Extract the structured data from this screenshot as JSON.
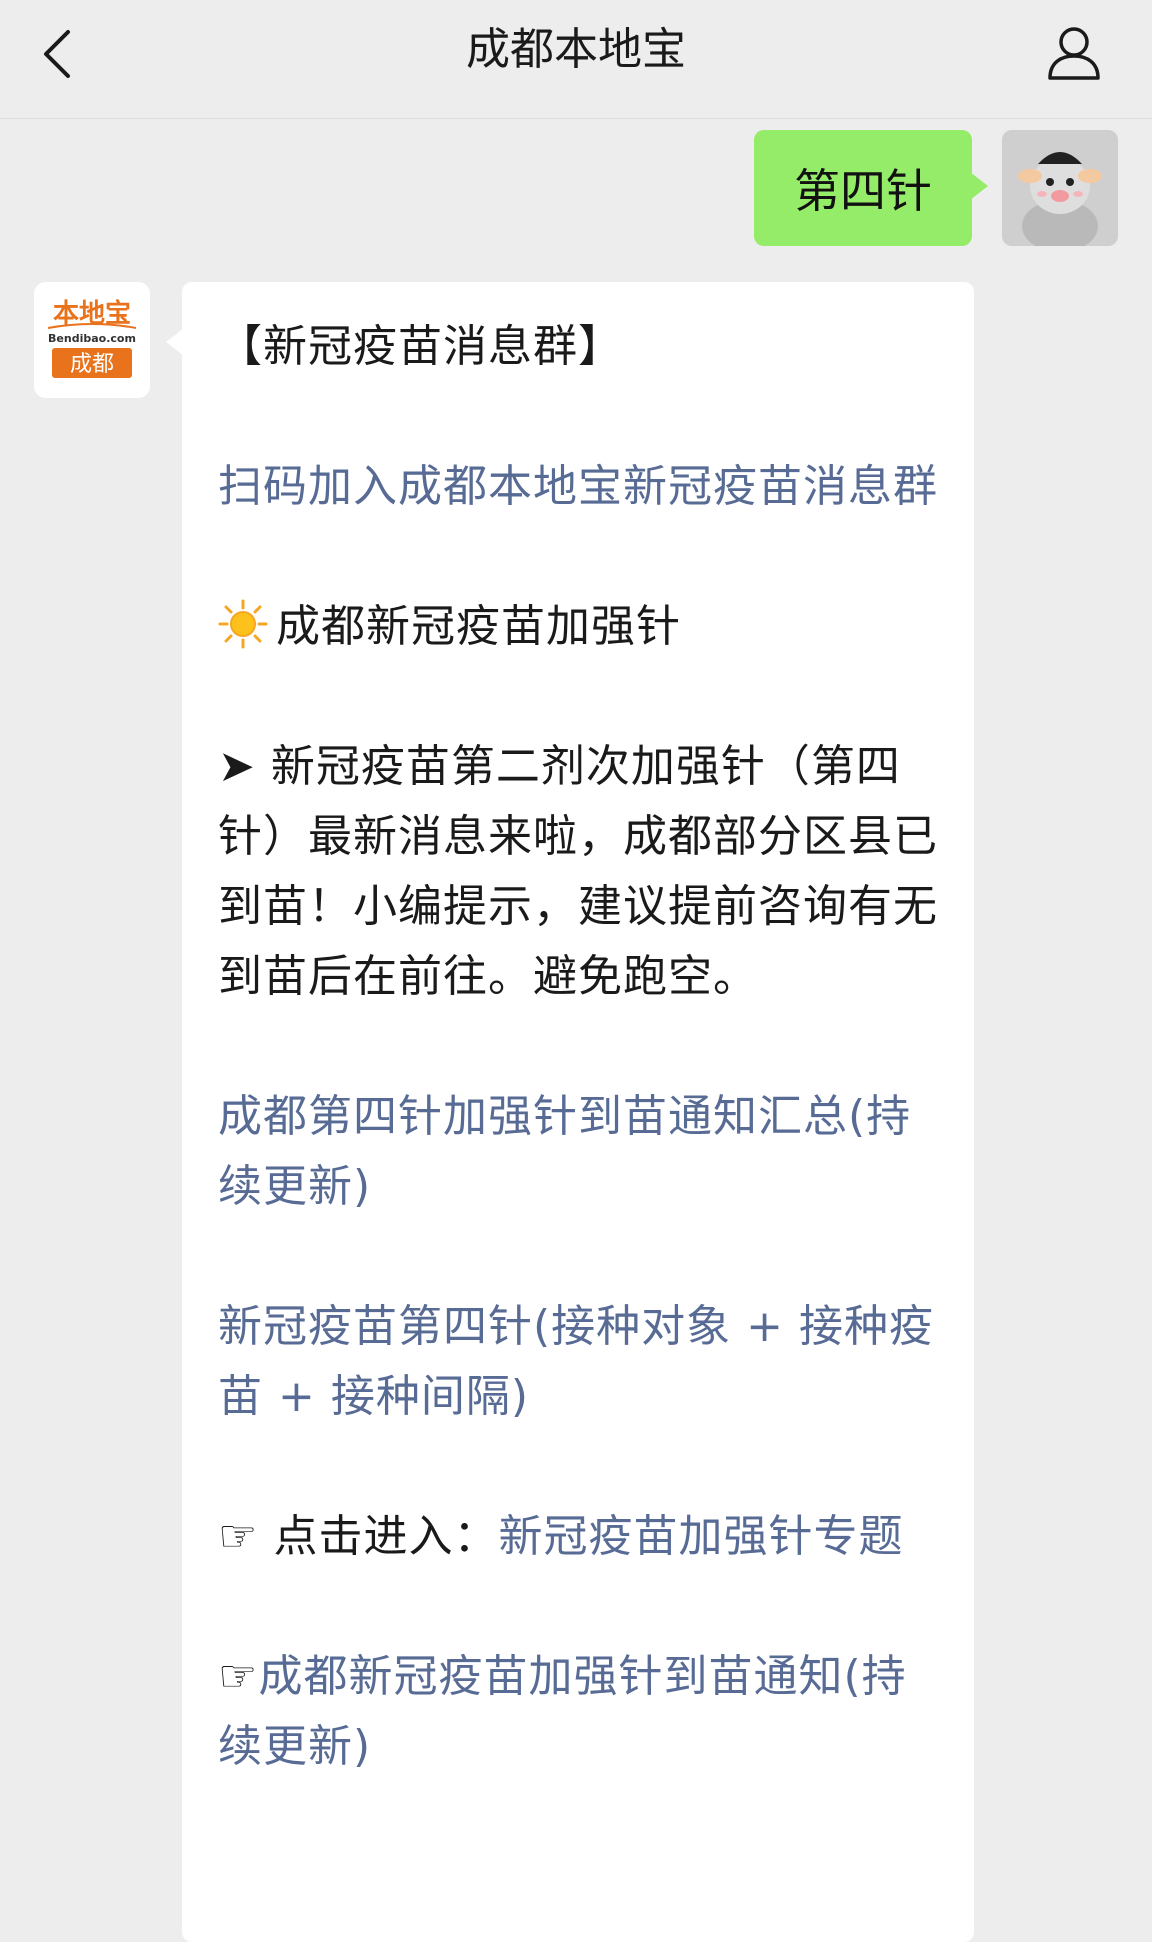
{
  "header": {
    "title": "成都本地宝"
  },
  "outgoing": {
    "text": "第四针"
  },
  "incoming": {
    "avatar": {
      "logo_text": "本地宝",
      "site": "Bendibao.com",
      "city": "成都"
    },
    "group_title": "【新冠疫苗消息群】",
    "scan_link": "扫码加入成都本地宝新冠疫苗消息群",
    "section_heading": "成都新冠疫苗加强针",
    "notice_arrow": "➤",
    "notice_text": " 新冠疫苗第二剂次加强针（第四针）最新消息来啦，成都部分区县已到苗！小编提示，建议提前咨询有无到苗后在前往。避免跑空。",
    "link_summary": "成都第四针加强针到苗通知汇总(持续更新)",
    "link_fourth_dose": "新冠疫苗第四针(接种对象 + 接种疫苗 + 接种间隔)",
    "click_hand": "☞",
    "click_enter_label": " 点击进入：",
    "link_topic": "新冠疫苗加强针专题",
    "link_notice": "成都新冠疫苗加强针到苗通知(持续更新)"
  },
  "colors": {
    "background": "#ededed",
    "outgoing_bubble": "#95ec69",
    "link": "#576b95",
    "brand_orange": "#e8731c"
  },
  "icons": {
    "back": "chevron-left-icon",
    "profile": "person-icon",
    "section": "sun-icon"
  }
}
